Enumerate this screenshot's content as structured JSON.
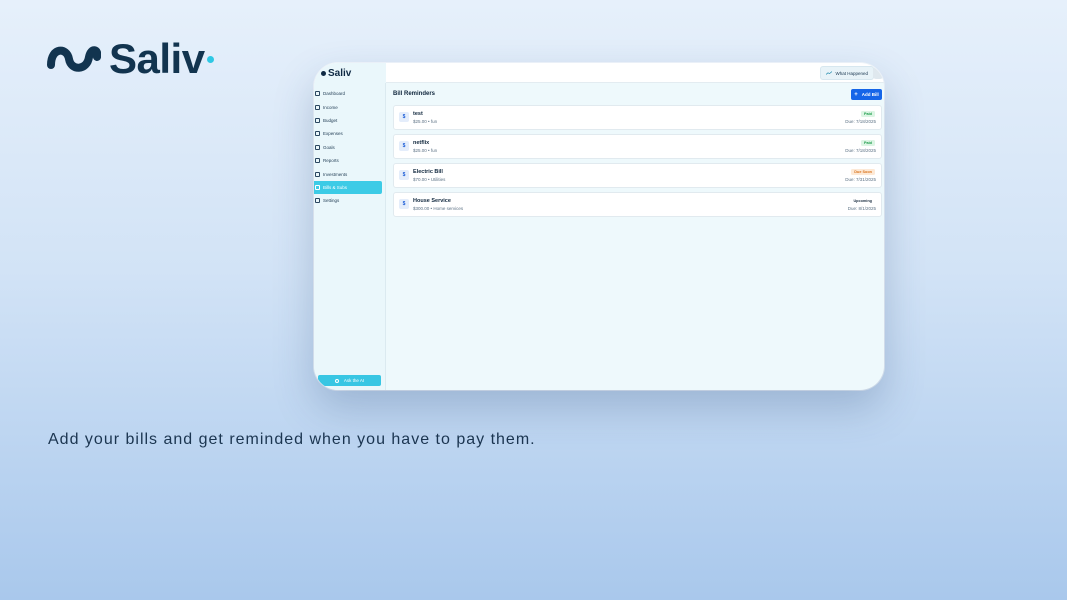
{
  "brand": {
    "name": "Saliv"
  },
  "tagline": "Add your bills and get reminded when you have to pay them.",
  "app": {
    "logo_text": "Saliv",
    "topbar": {
      "whats_happened_label": "What Happened"
    },
    "sidebar": {
      "items": [
        {
          "label": "Dashboard",
          "icon": "dashboard-icon",
          "active": false
        },
        {
          "label": "Income",
          "icon": "dollar-icon",
          "active": false
        },
        {
          "label": "Budget",
          "icon": "budget-icon",
          "active": false
        },
        {
          "label": "Expenses",
          "icon": "expenses-icon",
          "active": false
        },
        {
          "label": "Goals",
          "icon": "goals-icon",
          "active": false
        },
        {
          "label": "Reports",
          "icon": "reports-icon",
          "active": false
        },
        {
          "label": "Investments",
          "icon": "investments-icon",
          "active": false
        },
        {
          "label": "Bills & Subs",
          "icon": "bills-icon",
          "active": true
        },
        {
          "label": "Settings",
          "icon": "settings-icon",
          "active": false
        }
      ],
      "ask_ai_label": "Ask the AI"
    },
    "main": {
      "title": "Bill Reminders",
      "add_bill_label": "Add Bill",
      "bills": [
        {
          "icon_glyph": "$",
          "name": "test",
          "meta": "$25.00 • fun",
          "status": "Paid",
          "status_color": "#1f9d4c",
          "status_bg": "#dcf5e4",
          "due": "Due: 7/18/2025"
        },
        {
          "icon_glyph": "$",
          "name": "netflix",
          "meta": "$25.00 • fun",
          "status": "Paid",
          "status_color": "#1f9d4c",
          "status_bg": "#dcf5e4",
          "due": "Due: 7/18/2025"
        },
        {
          "icon_glyph": "$",
          "name": "Electric Bill",
          "meta": "$70.00 • Utilities",
          "status": "Due Soon",
          "status_color": "#d9721a",
          "status_bg": "#fde9d6",
          "due": "Due: 7/31/2025"
        },
        {
          "icon_glyph": "$",
          "name": "House Service",
          "meta": "$300.00 • Home services",
          "status": "Upcoming",
          "status_color": "#1d2f42",
          "status_bg": "#ffffff",
          "due": "Due: 8/1/2025"
        }
      ]
    }
  },
  "colors": {
    "accent": "#3ccbe6",
    "primary_button": "#1565e8",
    "brand_dark": "#12344f"
  }
}
